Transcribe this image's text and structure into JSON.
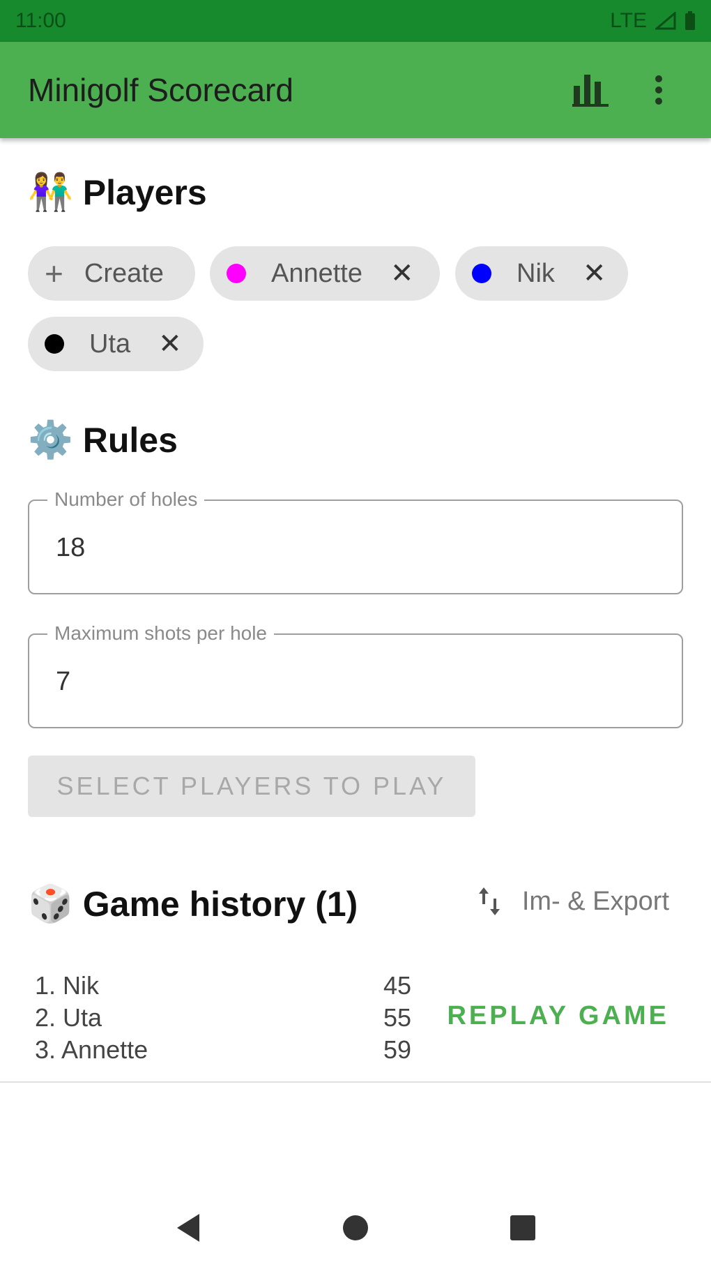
{
  "status_bar": {
    "time": "11:00",
    "network": "LTE"
  },
  "app_bar": {
    "title": "Minigolf Scorecard"
  },
  "players": {
    "emoji": "👫",
    "title": "Players",
    "create_label": "Create",
    "chips": [
      {
        "name": "Annette",
        "color": "#ff00ff"
      },
      {
        "name": "Nik",
        "color": "#0000ff"
      },
      {
        "name": "Uta",
        "color": "#000000"
      }
    ]
  },
  "rules": {
    "emoji": "⚙️",
    "title": "Rules",
    "holes_label": "Number of holes",
    "holes_value": "18",
    "max_shots_label": "Maximum shots per hole",
    "max_shots_value": "7"
  },
  "start_button": "SELECT PLAYERS TO PLAY",
  "history": {
    "emoji": "🎲",
    "title": "Game history (1)",
    "export_label": "Im- & Export",
    "games": [
      {
        "results": [
          {
            "rank": "1. Nik",
            "score": "45"
          },
          {
            "rank": "2. Uta",
            "score": "55"
          },
          {
            "rank": "3. Annette",
            "score": "59"
          }
        ],
        "replay_label": "REPLAY GAME"
      }
    ]
  },
  "colors": {
    "primary": "#4caf50",
    "status_bar": "#168a2c"
  }
}
